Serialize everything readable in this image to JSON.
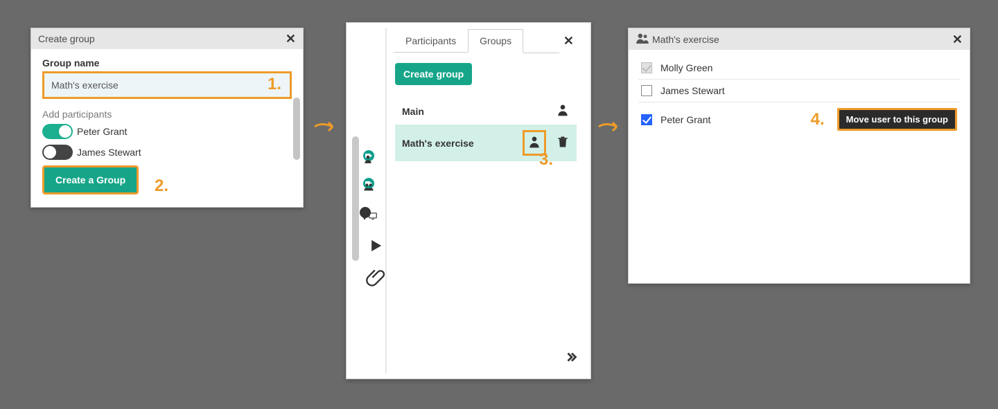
{
  "panel1": {
    "title": "Create group",
    "group_name_label": "Group name",
    "group_name_value": "Math's exercise",
    "add_participants_label": "Add participants",
    "participants": [
      {
        "name": "Peter Grant",
        "on": true
      },
      {
        "name": "James Stewart",
        "on": false
      }
    ],
    "create_button": "Create a Group",
    "step1": "1.",
    "step2": "2."
  },
  "panel2": {
    "tabs": {
      "participants": "Participants",
      "groups": "Groups"
    },
    "create_button": "Create group",
    "rows": [
      {
        "name": "Main",
        "has_trash": false
      },
      {
        "name": "Math's exercise",
        "has_trash": true
      }
    ],
    "step3": "3."
  },
  "panel3": {
    "title": "Math's exercise",
    "users": [
      {
        "name": "Molly Green",
        "state": "disabled"
      },
      {
        "name": "James Stewart",
        "state": "unchecked"
      },
      {
        "name": "Peter Grant",
        "state": "checked"
      }
    ],
    "move_button": "Move user to this group",
    "step4": "4."
  },
  "colors": {
    "accent": "#17a589",
    "highlight": "#ed9b2a"
  }
}
